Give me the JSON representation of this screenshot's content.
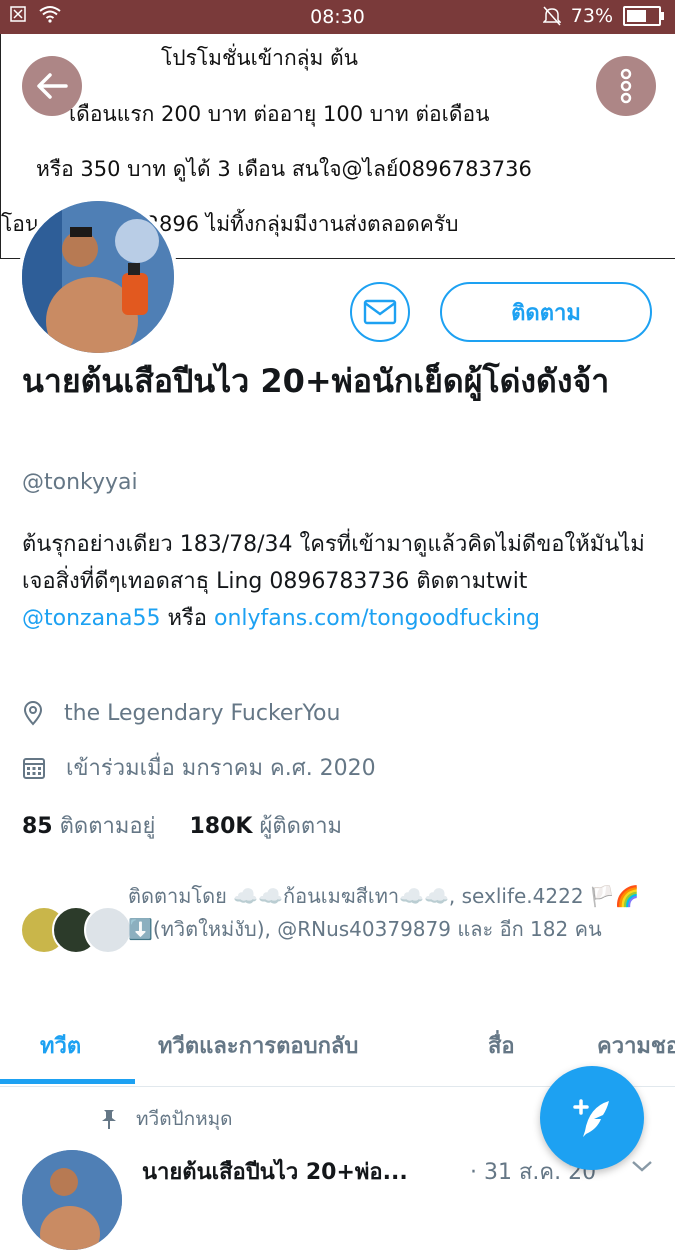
{
  "status_bar": {
    "time": "08:30",
    "battery": "73%",
    "battery_level": 0.73
  },
  "banner": {
    "lines": [
      "โปรโมชั่นเข้ากลุ่ม ต้น",
      "เดือนแรก 200 บาท ต่ออายุ 100 บาท ต่อเดือน",
      "หรือ 350 บาท  ดูได้ 3 เดือน สนใจ@ไลย์0896783736",
      "โอน                 ล 7582492896 ไม่ทิ้งกลุ่มมีงานส่งตลอดครับ"
    ]
  },
  "profile": {
    "follow_label": "ติดตาม",
    "name": "นายต้นเสือปีนไว 20+พ่อนักเย็ดผู้โด่งดังจ้า",
    "handle": "@tonkyyai",
    "bio_text_1": "ต้นรุกอย่างเดียว 183/78/34 ใครที่เข้ามาดูแล้วคิดไม่ดีขอให้มันไม่เจอสิ่งที่ดีๆเทอดสาธุ  Ling 0896783736 ติดตามtwit ",
    "bio_link_1": "@tonzana55",
    "bio_text_2": " หรือ ",
    "bio_link_2": "onlyfans.com/tongoodfucking",
    "location": "the Legendary FuckerYou",
    "joined": "เข้าร่วมเมื่อ มกราคม ค.ศ. 2020",
    "following_count": "85",
    "following_label": "ติดตามอยู่",
    "followers_count": "180K",
    "followers_label": "ผู้ติดตาม",
    "followed_by": "ติดตามโดย ☁️☁️ก้อนเมฆสีเทา☁️☁️, sexlife.4222 🏳️🌈⬇️(ทวิตใหม่งับ), @RNus40379879 และ อีก 182 คน"
  },
  "tabs": [
    {
      "label": "ทวีต",
      "active": true
    },
    {
      "label": "ทวีตและการตอบกลับ",
      "active": false
    },
    {
      "label": "สื่อ",
      "active": false
    },
    {
      "label": "ความชอบ",
      "active": false
    }
  ],
  "pinned_label": "ทวีตปักหมุด",
  "tweet": {
    "name": "นายต้นเสือปีนไว 20+พ่อ...",
    "date": "· 31 ส.ค. 20"
  },
  "colors": {
    "accent": "#1da1f2",
    "status_bar": "#7a3a3a"
  }
}
